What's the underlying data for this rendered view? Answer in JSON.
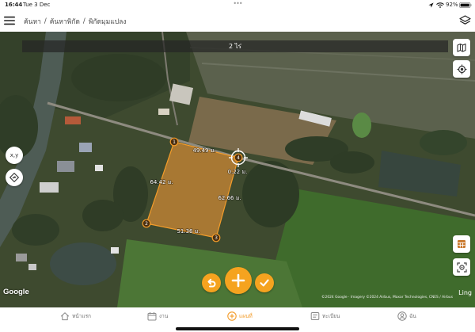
{
  "status_bar": {
    "time": "16:44",
    "date": "Tue 3 Dec",
    "dots": "•••",
    "battery": "92%"
  },
  "header": {
    "breadcrumb": [
      "ค้นหา",
      "ค้นหาพิกัด",
      "พิกัดมุมแปลง"
    ],
    "separator": "/",
    "icons": {
      "menu": "hamburger-icon",
      "layers": "layers-icon"
    }
  },
  "map": {
    "area_label": "2 ไร่",
    "vertices": [
      "1",
      "2",
      "3",
      "4"
    ],
    "edges": {
      "top": "49.49 ม.",
      "left": "64.42 ม.",
      "right": "62.66 ม.",
      "bottom": "51.36 ม."
    },
    "cursor_distance": "0.22 ม.",
    "coord_button": "x,y",
    "google_logo": "Google",
    "attribution": "©2024 Google · Imagery ©2024 Airbus, Maxar Technologies, CNES / Airbus",
    "attribution_tail": "Ling",
    "polygon_color": "#f39c2a",
    "icons": {
      "map_type": "map-icon",
      "locate": "target-icon",
      "navigate": "diamond-navigation-icon",
      "table": "table-icon",
      "scan": "scan-icon",
      "undo": "undo-icon",
      "add": "plus-icon",
      "confirm": "check-icon"
    }
  },
  "tab_bar": {
    "items": [
      {
        "label": "หน้าแรก",
        "icon": "home-icon"
      },
      {
        "label": "งาน",
        "icon": "calendar-icon"
      },
      {
        "label": "แผนที่",
        "icon": "add-circle-icon",
        "active": true
      },
      {
        "label": "ทะเบียน",
        "icon": "list-icon"
      },
      {
        "label": "ฉัน",
        "icon": "person-icon"
      }
    ]
  },
  "colors": {
    "accent": "#f5a31f",
    "active_tab": "#f39c2a",
    "tab_inactive": "#777777"
  }
}
